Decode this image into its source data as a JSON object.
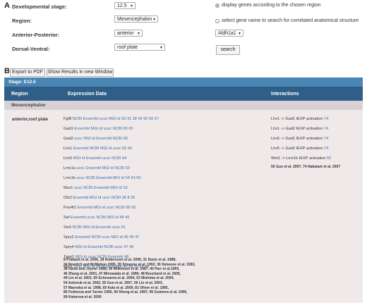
{
  "panel_a": "A",
  "panel_b": "B",
  "form": {
    "stage_label": "Developmental stage:",
    "stage_value": "12.5",
    "region_label": "Region:",
    "region_value": "Mesencephalon",
    "ap_label": "Anterior-Posterior:",
    "ap_value": "anterior",
    "dv_label": "Dorsal-Ventral:",
    "dv_value": "roof plate",
    "radio1": "display genes according to the chosen region",
    "radio2": "select gene name to search for correlated anatomical structure",
    "gene_value": "Aldh1a1",
    "search_label": "search"
  },
  "toolbar": {
    "export_label": "Export to PDF",
    "window_label": "Show Results in new Window"
  },
  "results": {
    "stage": "Stage: E12.5",
    "col_region": "Region",
    "col_expression": "Expression Data",
    "col_interactions": "Interactions",
    "section": "Mesencephalon",
    "region_name": "anterior,roof plate",
    "genes": [
      {
        "gene": "Fgf8",
        "links": "NCBI Ensembl ucsc MGI id",
        "refs": "50 31 38 49 55 56 57"
      },
      {
        "gene": "Gad1",
        "links": "Ensembl MGI id ucsc NCBI",
        "refs": "95 65"
      },
      {
        "gene": "Gad2",
        "links": "ucsc MGI id Ensembl NCBI",
        "refs": "99"
      },
      {
        "gene": "Lhx1",
        "links": "Ensembl NCBI MGI id ucsc",
        "refs": "65 94"
      },
      {
        "gene": "Lhx5",
        "links": "MGI id Ensembl ucsc NCBI",
        "refs": "94"
      },
      {
        "gene": "Lmx1a",
        "links": "ucsc Ensembl MGI id NCBI",
        "refs": "53"
      },
      {
        "gene": "Lmx1b",
        "links": "ucsc NCBI Ensembl MGI id",
        "refs": "54 53 55"
      },
      {
        "gene": "Msx1",
        "links": "ucsc NCBI Ensembl MGI id",
        "refs": "18"
      },
      {
        "gene": "Otx2",
        "links": "Ensembl MGI id ucsc NCBI",
        "refs": "36 8 35"
      },
      {
        "gene": "Pou4f1",
        "links": "Ensembl MGI id ucsc NCBI",
        "refs": "85 65"
      },
      {
        "gene": "Sef",
        "links": "Ensembl ucsc NCBI MGI id",
        "refs": "48 49"
      },
      {
        "gene": "Six3",
        "links": "NCBI MGI id Ensembl ucsc",
        "refs": "81"
      },
      {
        "gene": "Spry2",
        "links": "Ensembl NCBI ucsc MGI id",
        "refs": "46 49 47"
      },
      {
        "gene": "Spry4",
        "links": "MGI id Ensembl NCBI ucsc",
        "refs": "47 46"
      },
      {
        "gene": "Tapp1",
        "links": "MGI id ucsc NCBI Ensembl",
        "refs": "48"
      },
      {
        "gene": "Wnt1",
        "links": "ucsc MGI id NCBI Ensembl",
        "refs": "34 38 39 55 40"
      }
    ],
    "interactions": [
      {
        "text": "Lhx1 -> Gad1 IEXP activation",
        "ref": "74"
      },
      {
        "text": "Lhx1 -> Gad2 IEXP activation",
        "ref": "74"
      },
      {
        "text": "Lhx5 -> Gad1 IEXP activation",
        "ref": "74"
      },
      {
        "text": "Lhx5 -> Gad2 IEXP activation",
        "ref": "74"
      },
      {
        "text": "Wnt1 -> Lmx1b IEXP activation",
        "ref": "55"
      }
    ],
    "interaction_refs": "55 Guo et al. 2007, 74 Nakatani et al. 2007",
    "references": [
      "8 Prakash et al. 2006, 18 Andersson et al. 2006, 31 Davis et al. 1988,",
      "34 Rowitch and McMahon 1995, 35 Simeone et al. 1992, 36 Simeone et al. 1993,",
      "38 Davis and Joyner 1988, 39 Wilkinson et al. 1987, 40 Parr et al.1993,",
      "46 Zhang et al. 2001, 47 Minowada et al. 1999, 48 Bouchard et al. 2005,",
      "49 Lin et al. 2002, 50 Echevarria et al. 2004, 53 Mishima et al. 2009,",
      "54 Asbreuk et al. 2002, 55 Guo et al. 2007, 56 Lin et al. 2003,",
      "57 Marnoka et al. 1998, 65 Kala et al. 2009, 81 Oliver et al. 1995,",
      "85 Fedtsova and Turner 1995, 94 Sheng et al. 1997, 95 Guimera et al. 2006,",
      "99 Katarova et al. 2000"
    ]
  }
}
